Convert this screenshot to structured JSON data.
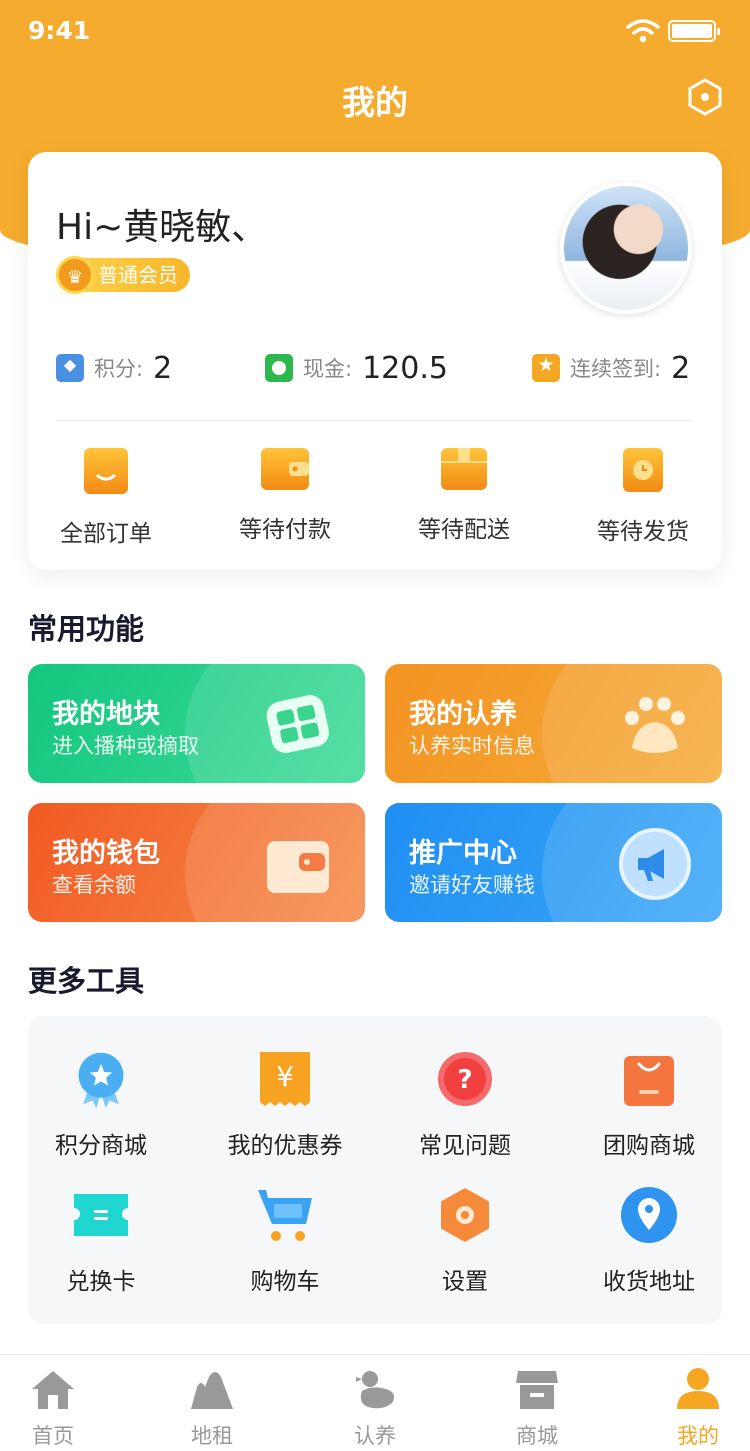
{
  "status_bar": {
    "time": "9:41"
  },
  "header": {
    "title": "我的"
  },
  "profile": {
    "greeting": "Hi~黄晓敏、",
    "member_level": "普通会员",
    "stats": [
      {
        "label": "积分:",
        "value": "2",
        "icon": "diamond-icon"
      },
      {
        "label": "现金:",
        "value": "120.5",
        "icon": "cash-icon"
      },
      {
        "label": "连续签到:",
        "value": "2",
        "icon": "star-icon"
      }
    ],
    "orders": [
      {
        "label": "全部订单",
        "icon": "bag-icon"
      },
      {
        "label": "等待付款",
        "icon": "wallet-icon"
      },
      {
        "label": "等待配送",
        "icon": "box-icon"
      },
      {
        "label": "等待发货",
        "icon": "clock-icon"
      }
    ]
  },
  "common": {
    "title": "常用功能",
    "items": [
      {
        "title": "我的地块",
        "subtitle": "进入播种或摘取",
        "color": "#1FCB86"
      },
      {
        "title": "我的认养",
        "subtitle": "认养实时信息",
        "color": "#F39A24"
      },
      {
        "title": "我的钱包",
        "subtitle": "查看余额",
        "color": "#F26A2E"
      },
      {
        "title": "推广中心",
        "subtitle": "邀请好友赚钱",
        "color": "#2196F3"
      }
    ]
  },
  "tools": {
    "title": "更多工具",
    "items": [
      {
        "label": "积分商城",
        "icon": "medal-icon"
      },
      {
        "label": "我的优惠券",
        "icon": "coupon-icon"
      },
      {
        "label": "常见问题",
        "icon": "question-icon"
      },
      {
        "label": "团购商城",
        "icon": "shopping-bag-icon"
      },
      {
        "label": "兑换卡",
        "icon": "ticket-icon"
      },
      {
        "label": "购物车",
        "icon": "cart-icon"
      },
      {
        "label": "设置",
        "icon": "settings-icon"
      },
      {
        "label": "收货地址",
        "icon": "location-icon"
      }
    ]
  },
  "tabbar": {
    "items": [
      {
        "label": "首页",
        "icon": "home-icon"
      },
      {
        "label": "地租",
        "icon": "land-icon"
      },
      {
        "label": "认养",
        "icon": "chicken-icon"
      },
      {
        "label": "商城",
        "icon": "store-icon"
      },
      {
        "label": "我的",
        "icon": "user-icon"
      }
    ],
    "active": "我的"
  },
  "colors": {
    "brand": "#F5AC2E",
    "active_tab": "#F5A623"
  }
}
